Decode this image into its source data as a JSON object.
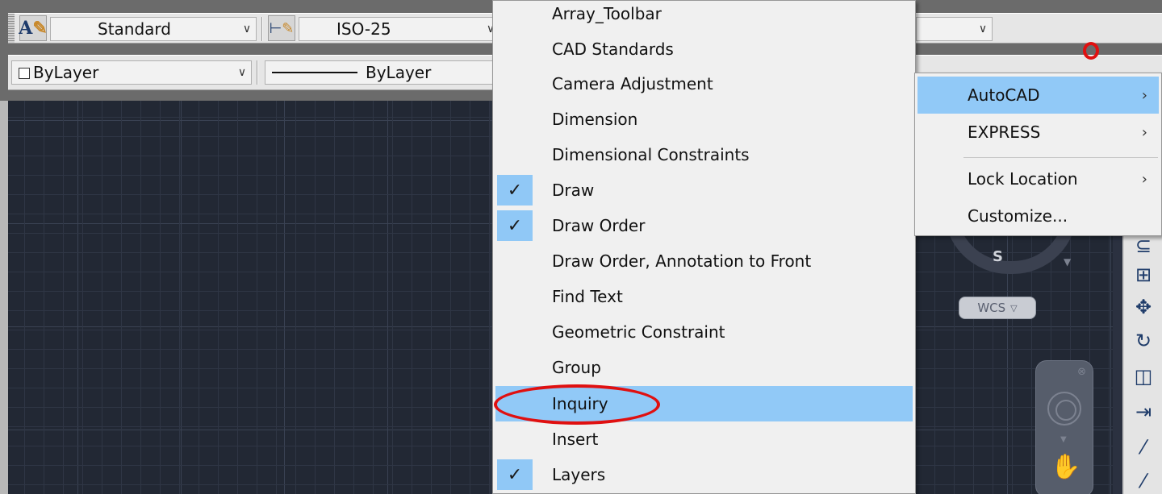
{
  "toolbar": {
    "text_style_value": "Standard",
    "dim_style_value": "ISO-25",
    "layer_color_value": "ByLayer",
    "linetype_value": "ByLayer"
  },
  "menu": {
    "items": [
      {
        "label": "Array_Toolbar",
        "checked": false
      },
      {
        "label": "CAD Standards",
        "checked": false
      },
      {
        "label": "Camera Adjustment",
        "checked": false
      },
      {
        "label": "Dimension",
        "checked": false
      },
      {
        "label": "Dimensional Constraints",
        "checked": false
      },
      {
        "label": "Draw",
        "checked": true
      },
      {
        "label": "Draw Order",
        "checked": true
      },
      {
        "label": "Draw Order, Annotation to Front",
        "checked": false
      },
      {
        "label": "Find Text",
        "checked": false
      },
      {
        "label": "Geometric Constraint",
        "checked": false
      },
      {
        "label": "Group",
        "checked": false
      },
      {
        "label": "Inquiry",
        "checked": false,
        "highlighted": true
      },
      {
        "label": "Insert",
        "checked": false
      },
      {
        "label": "Layers",
        "checked": true
      }
    ]
  },
  "submenu": {
    "items": [
      {
        "label": "AutoCAD",
        "has_submenu": true,
        "highlighted": true
      },
      {
        "label": "EXPRESS",
        "has_submenu": true
      },
      {
        "label": "Lock Location",
        "has_submenu": true
      },
      {
        "label": "Customize...",
        "has_submenu": false
      }
    ]
  },
  "viewcube": {
    "compass_label": "S",
    "ucs_label": "WCS"
  },
  "colors": {
    "highlight": "#91c9f7",
    "annotation_red": "#e01010",
    "canvas_bg": "#222834"
  }
}
